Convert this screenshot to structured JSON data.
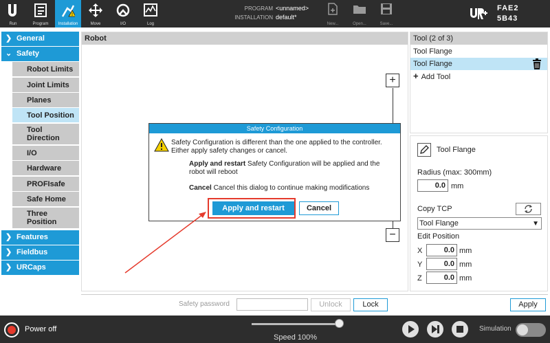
{
  "topbar": {
    "nav": [
      {
        "label": "Run",
        "icon": "run-icon"
      },
      {
        "label": "Program",
        "icon": "program-icon"
      },
      {
        "label": "Installation",
        "icon": "installation-icon"
      },
      {
        "label": "Move",
        "icon": "move-icon"
      },
      {
        "label": "I/O",
        "icon": "io-icon"
      },
      {
        "label": "Log",
        "icon": "log-icon"
      }
    ],
    "program_key": "PROGRAM",
    "program_value": "<unnamed>",
    "installation_key": "INSTALLATION",
    "installation_value": "default*",
    "file_buttons": [
      {
        "label": "New...",
        "icon": "new-file-icon"
      },
      {
        "label": "Open...",
        "icon": "open-folder-icon"
      },
      {
        "label": "Save...",
        "icon": "save-icon"
      }
    ],
    "robot_id_line1": "FAE2",
    "robot_id_line2": "5B43"
  },
  "sidebar": {
    "sections": [
      {
        "label": "General"
      },
      {
        "label": "Safety"
      },
      {
        "label": "Features"
      },
      {
        "label": "Fieldbus"
      },
      {
        "label": "URCaps"
      }
    ],
    "safety_items": [
      {
        "label": "Robot Limits"
      },
      {
        "label": "Joint Limits"
      },
      {
        "label": "Planes"
      },
      {
        "label": "Tool Position"
      },
      {
        "label": "Tool Direction"
      },
      {
        "label": "I/O"
      },
      {
        "label": "Hardware"
      },
      {
        "label": "PROFIsafe"
      },
      {
        "label": "Safe Home"
      },
      {
        "label": "Three Position"
      }
    ]
  },
  "robot_panel": {
    "title": "Robot",
    "zoom_in": "+",
    "zoom_out": "−"
  },
  "tool_panel": {
    "title": "Tool (2 of 3)",
    "items": [
      "Tool Flange",
      "Tool Flange"
    ],
    "add_label": "Add Tool"
  },
  "config": {
    "name": "Tool Flange",
    "radius_label": "Radius (max: 300mm)",
    "radius_value": "0.0",
    "unit": "mm",
    "copy_tcp_label": "Copy TCP",
    "copy_tcp_value": "Tool Flange",
    "edit_position_label": "Edit Position",
    "x_label": "X",
    "x_value": "0.0",
    "y_label": "Y",
    "y_value": "0.0",
    "z_label": "Z",
    "z_value": "0.0"
  },
  "bottom": {
    "password_label": "Safety password",
    "password_value": "",
    "unlock_label": "Unlock",
    "lock_label": "Lock",
    "apply_label": "Apply"
  },
  "footer": {
    "power_label": "Power off",
    "speed_label": "Speed 100%",
    "speed_fraction": 1.0,
    "simulation_label": "Simulation"
  },
  "dialog": {
    "title": "Safety Configuration",
    "message": "Safety Configuration is different than the one applied to the controller. Either apply safety changes or cancel.",
    "apply_bold": "Apply and restart",
    "apply_desc": "Safety Configuration will be applied and the robot will reboot",
    "cancel_bold": "Cancel",
    "cancel_desc": "Cancel this dialog to continue making modifications",
    "apply_button": "Apply and restart",
    "cancel_button": "Cancel"
  },
  "colors": {
    "accent": "#1e9ad6",
    "highlight": "#e53a2c",
    "topbar": "#2d2d2d"
  }
}
